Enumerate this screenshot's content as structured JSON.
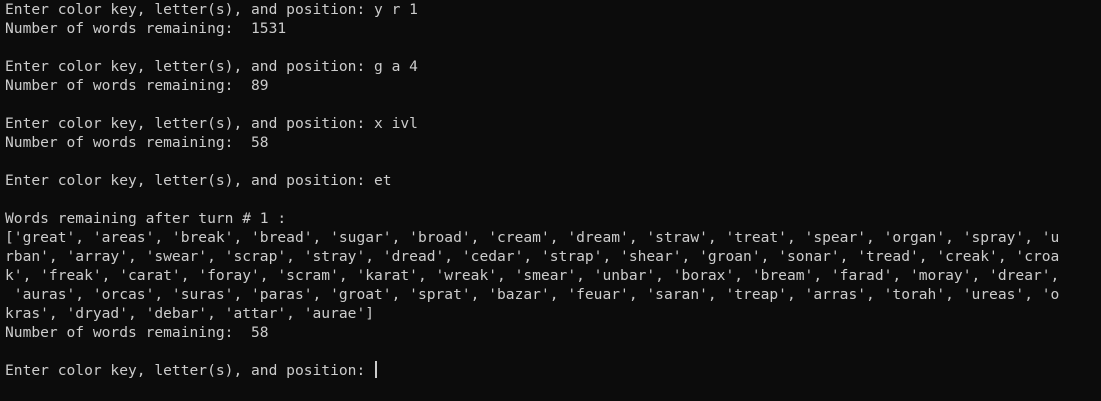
{
  "terminal": {
    "lines": [
      "Enter color key, letter(s), and position: y r 1",
      "Number of words remaining:  1531",
      "",
      "Enter color key, letter(s), and position: g a 4",
      "Number of words remaining:  89",
      "",
      "Enter color key, letter(s), and position: x ivl",
      "Number of words remaining:  58",
      "",
      "Enter color key, letter(s), and position: et",
      "",
      "Words remaining after turn # 1 :",
      "['great', 'areas', 'break', 'bread', 'sugar', 'broad', 'cream', 'dream', 'straw', 'treat', 'spear', 'organ', 'spray', 'u",
      "rban', 'array', 'swear', 'scrap', 'stray', 'dread', 'cedar', 'strap', 'shear', 'groan', 'sonar', 'tread', 'creak', 'croa",
      "k', 'freak', 'carat', 'foray', 'scram', 'karat', 'wreak', 'smear', 'unbar', 'borax', 'bream', 'farad', 'moray', 'drear',",
      " 'auras', 'orcas', 'suras', 'paras', 'groat', 'sprat', 'bazar', 'feuar', 'saran', 'treap', 'arras', 'torah', 'ureas', 'o",
      "kras', 'dryad', 'debar', 'attar', 'aurae']",
      "Number of words remaining:  58",
      ""
    ],
    "prompt": "Enter color key, letter(s), and position: "
  }
}
